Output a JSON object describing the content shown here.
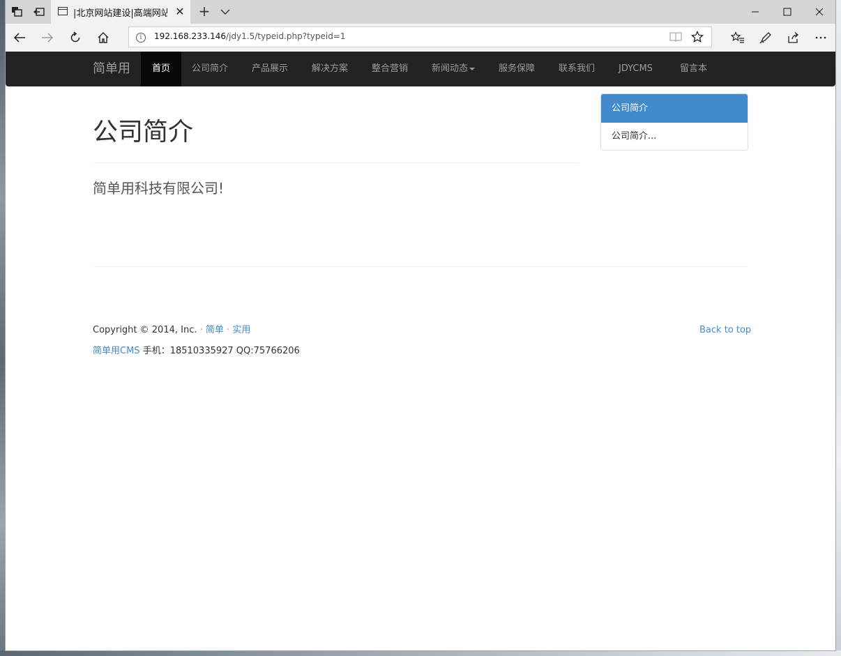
{
  "browser": {
    "tab_title": "|北京网站建设|高端网站",
    "url_host": "192.168.233.146",
    "url_path": "/jdy1.5/typeid.php?typeid=1",
    "icons": {
      "tab_actions": "tabs-aside-icon",
      "set_aside": "set-aside-icon",
      "back": "back-arrow-icon",
      "forward": "forward-arrow-icon",
      "refresh": "refresh-icon",
      "home": "home-icon",
      "reading_view": "reading-view-icon",
      "favorite": "star-icon",
      "favorites_hub": "favorites-list-icon",
      "notes": "pen-icon",
      "share": "share-icon",
      "more": "more-dots-icon"
    }
  },
  "site": {
    "brand": "简单用",
    "nav": [
      {
        "label": "首页",
        "active": true
      },
      {
        "label": "公司简介"
      },
      {
        "label": "产品展示"
      },
      {
        "label": "解决方案"
      },
      {
        "label": "整合营销"
      },
      {
        "label": "新闻动态",
        "dropdown": true
      },
      {
        "label": "服务保障"
      },
      {
        "label": "联系我们"
      },
      {
        "label": "JDYCMS"
      },
      {
        "label": "留言本"
      }
    ],
    "colors": {
      "navbar": "#222222",
      "accent": "#428bca"
    }
  },
  "content": {
    "title": "公司简介",
    "lead": "简单用科技有限公司!"
  },
  "sidebar": {
    "header": "公司简介",
    "items": [
      "公司简介..."
    ]
  },
  "footer": {
    "copyright": "Copyright © 2014, Inc.",
    "sep": "·",
    "link1": "简单",
    "link2": "实用",
    "cms_link": "简单用CMS",
    "contact": "手机：18510335927 QQ:75766206",
    "back_to_top": "Back to top"
  }
}
